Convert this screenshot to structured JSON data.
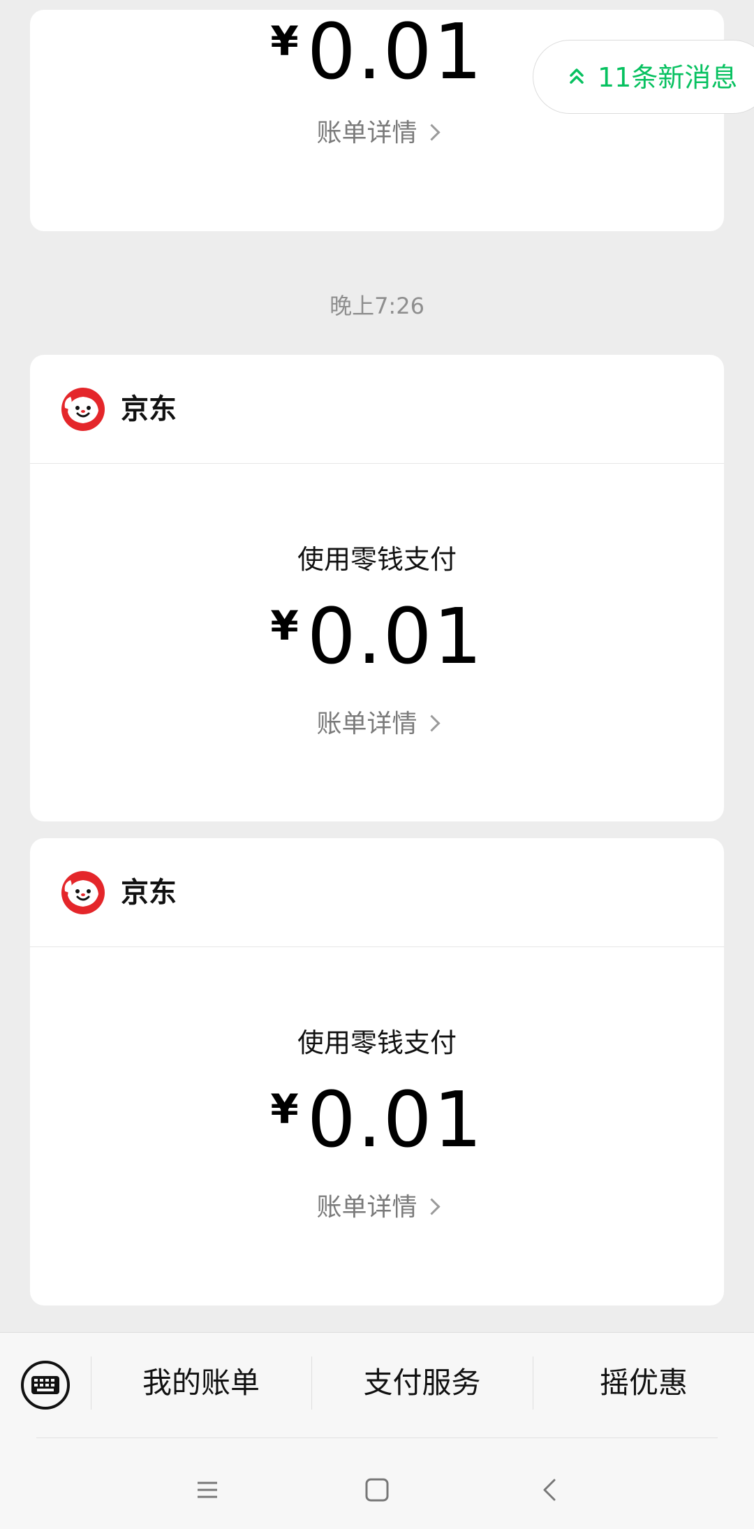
{
  "new_messages": {
    "label": "11条新消息",
    "accent_color": "#07c160",
    "icon": "double-chevron-up-icon"
  },
  "timestamp": "晚上7:26",
  "messages": [
    {
      "amount_symbol": "¥",
      "amount": "0.01",
      "detail_label": "账单详情"
    },
    {
      "merchant": "京东",
      "merchant_icon": "jd-logo-icon",
      "pay_method": "使用零钱支付",
      "amount_symbol": "¥",
      "amount": "0.01",
      "detail_label": "账单详情"
    },
    {
      "merchant": "京东",
      "merchant_icon": "jd-logo-icon",
      "pay_method": "使用零钱支付",
      "amount_symbol": "¥",
      "amount": "0.01",
      "detail_label": "账单详情"
    }
  ],
  "bottom_menu": {
    "keyboard_icon": "keyboard-icon",
    "items": [
      {
        "label": "我的账单"
      },
      {
        "label": "支付服务"
      },
      {
        "label": "摇优惠"
      }
    ]
  },
  "system_nav": {
    "menu_icon": "menu-icon",
    "home_icon": "home-square-icon",
    "back_icon": "back-chevron-icon"
  }
}
